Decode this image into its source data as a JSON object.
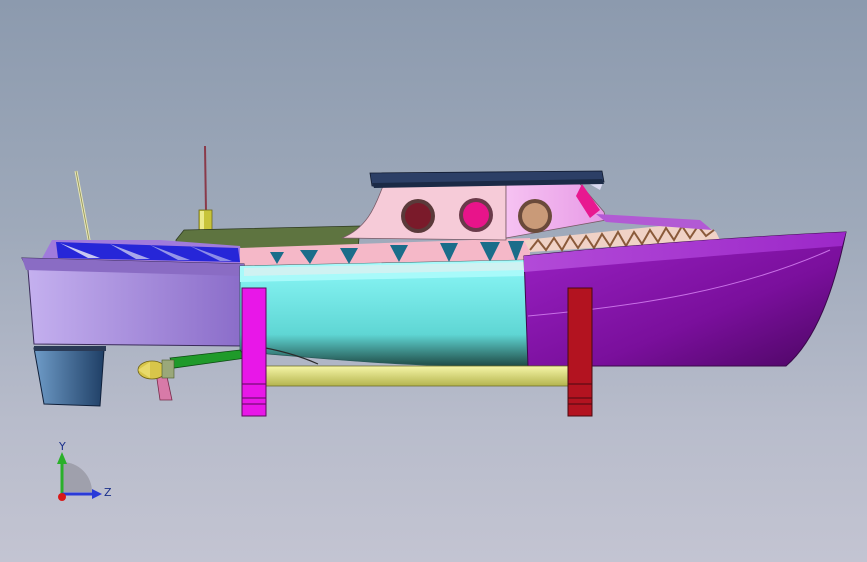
{
  "viewport": {
    "background_top": "#8c9aae",
    "background_bottom": "#c3c4d2"
  },
  "model": {
    "name": "boat-model",
    "colors": {
      "hull_rear": "#a78ce0",
      "hull_front": "#8e1ab8",
      "hull_mid": "#86f4f4",
      "cabin": "#f3c6ea",
      "roof": "#2c3f66",
      "deck_stripe": "#2626d8",
      "support_magenta": "#e817e8",
      "support_red": "#b31320",
      "shaft": "#e6e685",
      "porthole_1": "#7a1a2a",
      "porthole_2": "#e8148a",
      "porthole_3": "#c99a78",
      "rudder": "#3d6a96",
      "propeller": "#d8c64a"
    }
  },
  "triad": {
    "y_label": "Y",
    "z_label": "Z",
    "y_icon": "axis-y-arrow",
    "z_icon": "axis-z-arrow",
    "x_icon": "axis-x-origin"
  }
}
